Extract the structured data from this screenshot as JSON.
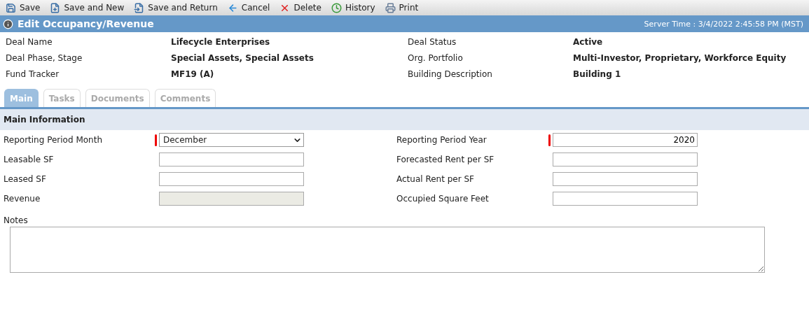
{
  "toolbar": [
    {
      "label": "Save",
      "kind": "save"
    },
    {
      "label": "Save and New",
      "kind": "new"
    },
    {
      "label": "Save and Return",
      "kind": "return"
    },
    {
      "label": "Cancel",
      "kind": "cancel"
    },
    {
      "label": "Delete",
      "kind": "delete"
    },
    {
      "label": "History",
      "kind": "history"
    },
    {
      "label": "Print",
      "kind": "print"
    }
  ],
  "title_bar": {
    "title": "Edit Occupancy/Revenue",
    "server_time": "Server Time : 3/4/2022 2:45:58 PM (MST)"
  },
  "summary": [
    {
      "label": "Deal Name",
      "value": "Lifecycle Enterprises"
    },
    {
      "label": "Deal Status",
      "value": "Active"
    },
    {
      "label": "Deal Phase, Stage",
      "value": "Special Assets, Special Assets"
    },
    {
      "label": "Org. Portfolio",
      "value": "Multi-Investor, Proprietary, Workforce Equity"
    },
    {
      "label": "Fund Tracker",
      "value": "MF19 (A)"
    },
    {
      "label": "Building Description",
      "value": "Building 1"
    }
  ],
  "tabs": [
    {
      "label": "Main",
      "selected": true
    },
    {
      "label": "Tasks",
      "selected": false
    },
    {
      "label": "Documents",
      "selected": false
    },
    {
      "label": "Comments",
      "selected": false
    }
  ],
  "section_title": "Main Information",
  "fields": [
    {
      "label": "Reporting Period Month",
      "kind": "select",
      "value": "December",
      "required": true
    },
    {
      "label": "Reporting Period Year",
      "kind": "text",
      "value": "2020",
      "required": true
    },
    {
      "label": "Leasable SF",
      "kind": "text",
      "required": false
    },
    {
      "label": "Forecasted Rent per SF",
      "kind": "text",
      "required": false
    },
    {
      "label": "Leased SF",
      "kind": "text",
      "required": false
    },
    {
      "label": "Actual Rent per SF",
      "kind": "text",
      "required": false
    },
    {
      "label": "Revenue",
      "kind": "readonly",
      "required": false
    },
    {
      "label": "Occupied Square Feet",
      "kind": "text",
      "required": false
    }
  ],
  "notes": {
    "label": "Notes"
  }
}
